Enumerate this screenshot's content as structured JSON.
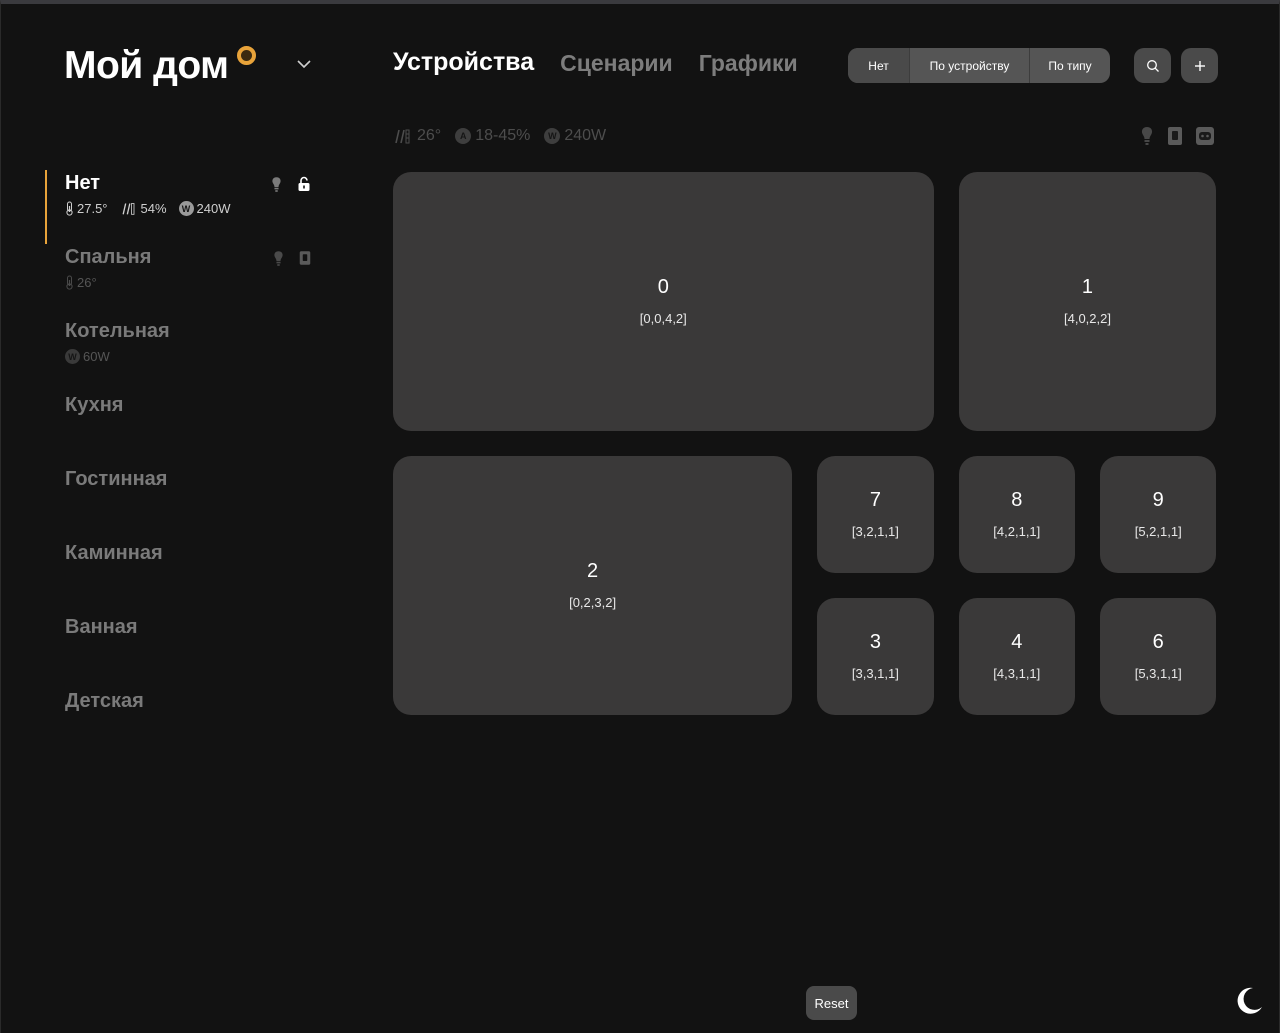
{
  "header": {
    "title": "Мой дом",
    "tabs": [
      {
        "label": "Устройства",
        "active": true
      },
      {
        "label": "Сценарии",
        "active": false
      },
      {
        "label": "Графики",
        "active": false
      }
    ],
    "group_by": [
      "Нет",
      "По устройству",
      "По типу"
    ],
    "group_by_selected": "Нет"
  },
  "summary": {
    "temperature": "26°",
    "humidity": "18-45%",
    "humidity_badge": "A",
    "power": "240W",
    "power_badge": "W"
  },
  "rooms": [
    {
      "name": "Нет",
      "active": true,
      "stats": {
        "temperature": "27.5°",
        "humidity": "54%",
        "power": "240W"
      },
      "icons": [
        "bulb-icon",
        "lock-open-icon"
      ]
    },
    {
      "name": "Спальня",
      "active": false,
      "stats": {
        "temperature": "26°"
      },
      "icons": [
        "bulb-icon",
        "switch-icon"
      ]
    },
    {
      "name": "Котельная",
      "active": false,
      "stats": {
        "power": "60W"
      },
      "icons": []
    },
    {
      "name": "Кухня",
      "active": false,
      "stats": {},
      "icons": []
    },
    {
      "name": "Гостинная",
      "active": false,
      "stats": {},
      "icons": []
    },
    {
      "name": "Каминная",
      "active": false,
      "stats": {},
      "icons": []
    },
    {
      "name": "Ванная",
      "active": false,
      "stats": {},
      "icons": []
    },
    {
      "name": "Детская",
      "active": false,
      "stats": {},
      "icons": []
    }
  ],
  "tiles": [
    {
      "id": "0",
      "pos": "[0,0,4,2]"
    },
    {
      "id": "1",
      "pos": "[4,0,2,2]"
    },
    {
      "id": "2",
      "pos": "[0,2,3,2]"
    },
    {
      "id": "7",
      "pos": "[3,2,1,1]"
    },
    {
      "id": "8",
      "pos": "[4,2,1,1]"
    },
    {
      "id": "9",
      "pos": "[5,2,1,1]"
    },
    {
      "id": "3",
      "pos": "[3,3,1,1]"
    },
    {
      "id": "4",
      "pos": "[4,3,1,1]"
    },
    {
      "id": "6",
      "pos": "[5,3,1,1]"
    }
  ],
  "footer": {
    "reset_label": "Reset"
  },
  "colors": {
    "accent": "#e8a33a",
    "background": "#121212",
    "tile": "#3a3939"
  }
}
